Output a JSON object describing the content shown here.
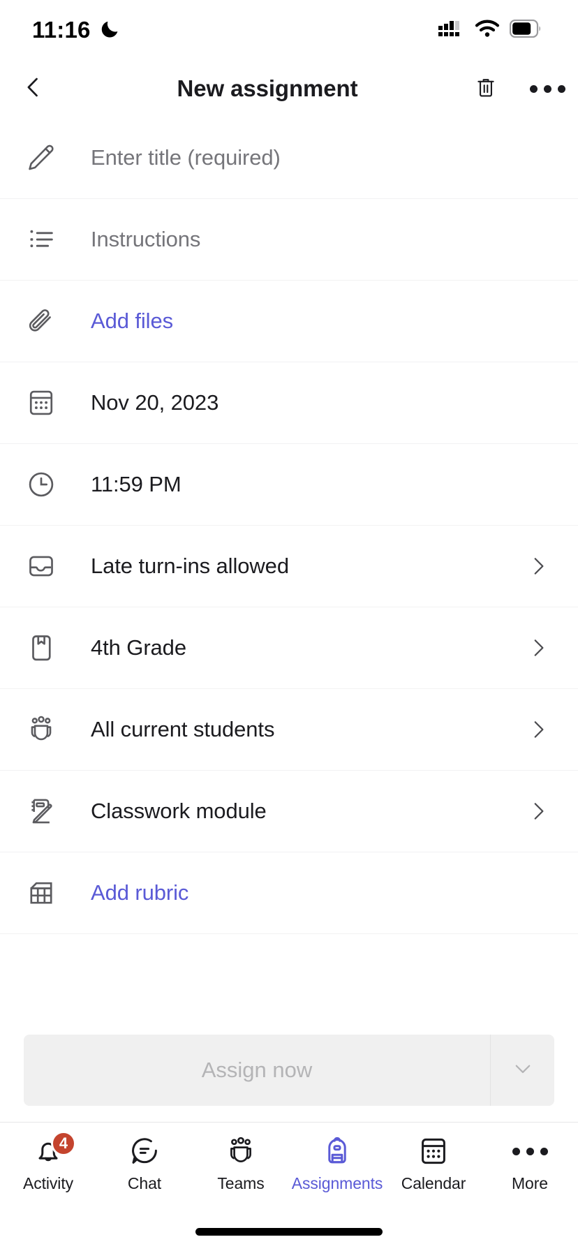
{
  "status_bar": {
    "time": "11:16",
    "dnd_icon": "moon-icon",
    "cellular_icon": "cellular-signal-icon",
    "wifi_icon": "wifi-icon",
    "battery_icon": "battery-icon"
  },
  "header": {
    "back_icon": "chevron-left-icon",
    "title": "New assignment",
    "delete_icon": "trash-icon",
    "more_icon": "ellipsis-horizontal-icon"
  },
  "form": {
    "rows": [
      {
        "icon": "pencil-icon",
        "label": "Enter title (required)",
        "placeholder": "Enter title (required)",
        "style": "placeholder",
        "chevron": false,
        "name": "title-field"
      },
      {
        "icon": "bulleted-list-icon",
        "label": "Instructions",
        "placeholder": "Instructions",
        "style": "placeholder",
        "chevron": false,
        "name": "instructions-field"
      },
      {
        "icon": "paperclip-icon",
        "label": "Add files",
        "style": "link",
        "chevron": false,
        "name": "add-files-row"
      },
      {
        "icon": "calendar-icon",
        "label": "Nov 20, 2023",
        "style": "value",
        "chevron": false,
        "name": "due-date-row"
      },
      {
        "icon": "clock-icon",
        "label": "11:59 PM",
        "style": "value",
        "chevron": false,
        "name": "due-time-row"
      },
      {
        "icon": "inbox-tray-icon",
        "label": "Late turn-ins allowed",
        "style": "value",
        "chevron": true,
        "name": "late-turn-ins-row"
      },
      {
        "icon": "bookmark-book-icon",
        "label": "4th Grade",
        "style": "value",
        "chevron": true,
        "name": "class-row"
      },
      {
        "icon": "people-team-icon",
        "label": "All current students",
        "style": "value",
        "chevron": true,
        "name": "assign-to-row"
      },
      {
        "icon": "classwork-module-icon",
        "label": "Classwork module",
        "style": "value",
        "chevron": true,
        "name": "classwork-module-row"
      },
      {
        "icon": "grid-table-icon",
        "label": "Add rubric",
        "style": "link",
        "chevron": false,
        "name": "add-rubric-row"
      }
    ]
  },
  "assign": {
    "primary_label": "Assign now",
    "dropdown_icon": "chevron-down-icon",
    "disabled": true
  },
  "bottom_nav": {
    "items": [
      {
        "icon": "bell-icon",
        "label": "Activity",
        "badge": "4",
        "active": false,
        "name": "nav-activity"
      },
      {
        "icon": "chat-bubble-icon",
        "label": "Chat",
        "badge": "",
        "active": false,
        "name": "nav-chat"
      },
      {
        "icon": "people-team-icon",
        "label": "Teams",
        "badge": "",
        "active": false,
        "name": "nav-teams"
      },
      {
        "icon": "backpack-icon",
        "label": "Assignments",
        "badge": "",
        "active": true,
        "name": "nav-assignments"
      },
      {
        "icon": "calendar-icon",
        "label": "Calendar",
        "badge": "",
        "active": false,
        "name": "nav-calendar"
      },
      {
        "icon": "ellipsis-horizontal-icon",
        "label": "More",
        "badge": "",
        "active": false,
        "name": "nav-more"
      }
    ]
  },
  "colors": {
    "accent_purple": "#5a5ad6",
    "badge_red": "#c4442e",
    "text_primary": "#1b1b1f",
    "text_placeholder": "#75757a",
    "divider": "#f2f2f3",
    "disabled_bg": "#f0f0f0",
    "disabled_text": "#b4b4b6"
  }
}
